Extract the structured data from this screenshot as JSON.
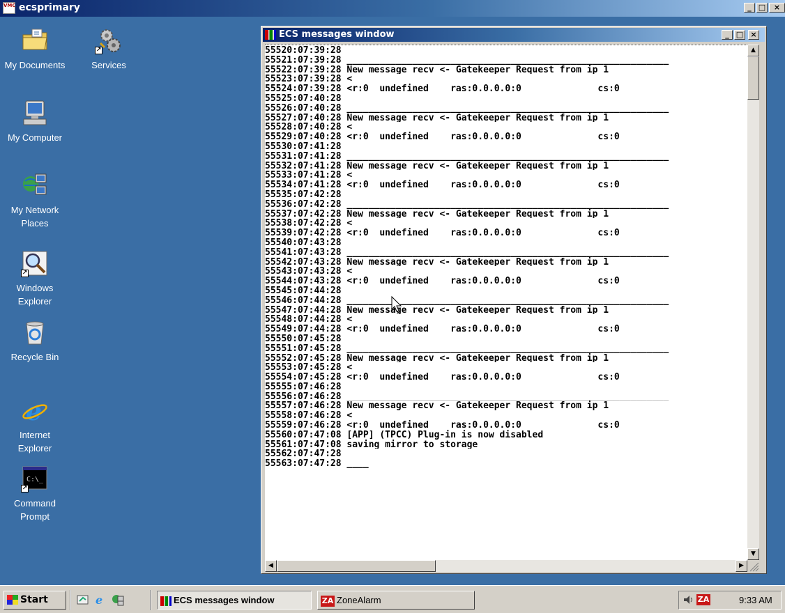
{
  "outer_window": {
    "title": "ecsprimary",
    "logo_text": "VMC",
    "min_glyph": "_",
    "max_glyph": "□",
    "close_glyph": "×"
  },
  "desktop": {
    "icons": [
      {
        "label": "My Documents",
        "icon": "folder-icon"
      },
      {
        "label": "Services",
        "icon": "gears-icon"
      },
      {
        "label": "My Computer",
        "icon": "computer-icon"
      },
      {
        "label": "My Network Places",
        "icon": "network-icon"
      },
      {
        "label": "Windows Explorer",
        "icon": "magnifier-icon"
      },
      {
        "label": "Recycle Bin",
        "icon": "recycle-bin-icon"
      },
      {
        "label": "Internet Explorer",
        "icon": "ie-icon"
      },
      {
        "label": "Command Prompt",
        "icon": "console-icon"
      }
    ],
    "console_icon_text": "C:\\_"
  },
  "ecs_window": {
    "title": "ECS messages window",
    "lines": [
      "55520:07:39:28",
      "55521:07:39:28 ___________________________________________________________",
      "55522:07:39:28 New message recv <- Gatekeeper Request from ip 1",
      "55523:07:39:28 <",
      "55524:07:39:28 <r:0  undefined    ras:0.0.0.0:0              cs:0",
      "55525:07:40:28",
      "55526:07:40:28 ___________________________________________________________",
      "55527:07:40:28 New message recv <- Gatekeeper Request from ip 1",
      "55528:07:40:28 <",
      "55529:07:40:28 <r:0  undefined    ras:0.0.0.0:0              cs:0",
      "55530:07:41:28",
      "55531:07:41:28 ___________________________________________________________",
      "55532:07:41:28 New message recv <- Gatekeeper Request from ip 1",
      "55533:07:41:28 <",
      "55534:07:41:28 <r:0  undefined    ras:0.0.0.0:0              cs:0",
      "55535:07:42:28",
      "55536:07:42:28 ___________________________________________________________",
      "55537:07:42:28 New message recv <- Gatekeeper Request from ip 1",
      "55538:07:42:28 <",
      "55539:07:42:28 <r:0  undefined    ras:0.0.0.0:0              cs:0",
      "55540:07:43:28",
      "55541:07:43:28 ___________________________________________________________",
      "55542:07:43:28 New message recv <- Gatekeeper Request from ip 1",
      "55543:07:43:28 <",
      "55544:07:43:28 <r:0  undefined    ras:0.0.0.0:0              cs:0",
      "55545:07:44:28",
      "55546:07:44:28 ___________________________________________________________",
      "55547:07:44:28 New message recv <- Gatekeeper Request from ip 1",
      "55548:07:44:28 <",
      "55549:07:44:28 <r:0  undefined    ras:0.0.0.0:0              cs:0",
      "55550:07:45:28",
      "55551:07:45:28 ___________________________________________________________",
      "55552:07:45:28 New message recv <- Gatekeeper Request from ip 1",
      "55553:07:45:28 <",
      "55554:07:45:28 <r:0  undefined    ras:0.0.0.0:0              cs:0",
      "55555:07:46:28",
      "55556:07:46:28 ___________________________________________________________",
      "55557:07:46:28 New message recv <- Gatekeeper Request from ip 1",
      "55558:07:46:28 <",
      "55559:07:46:28 <r:0  undefined    ras:0.0.0.0:0              cs:0",
      "55560:07:47:08 [APP] (TPCC) Plug-in is now disabled",
      "55561:07:47:08 saving mirror to storage",
      "55562:07:47:28",
      "55563:07:47:28 ____"
    ],
    "scroll_up": "▲",
    "scroll_down": "▼",
    "scroll_left": "◀",
    "scroll_right": "▶"
  },
  "taskbar": {
    "start_label": "Start",
    "tasks": [
      {
        "label": "ECS messages window",
        "active": true
      },
      {
        "label": "ZoneAlarm",
        "active": false
      }
    ],
    "za_badge": "ZA",
    "clock": "9:33 AM"
  },
  "colors": {
    "desktop": "#3a6ea5",
    "title_active": "#0a246a",
    "face": "#d4d0c8"
  }
}
